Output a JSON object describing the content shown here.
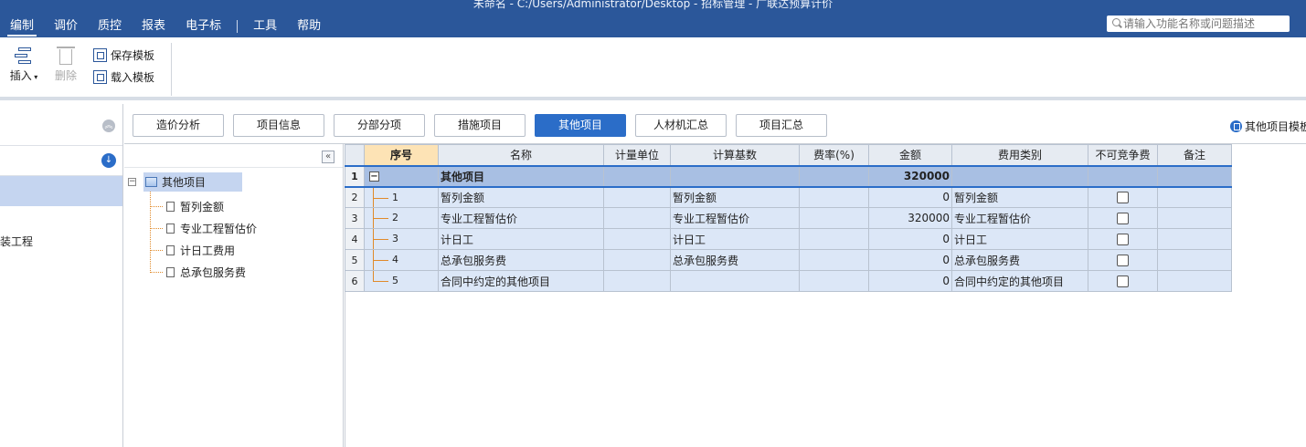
{
  "window": {
    "title": "未命名 - C:/Users/Administrator/Desktop - 招标管理 - 广联达预算计价"
  },
  "menu": {
    "items": [
      {
        "label": "编制",
        "active": true
      },
      {
        "label": "调价"
      },
      {
        "label": "质控"
      },
      {
        "label": "报表"
      },
      {
        "label": "电子标"
      },
      {
        "label": "工具"
      },
      {
        "label": "帮助"
      }
    ],
    "search_placeholder": "请输入功能名称或问题描述"
  },
  "ribbon": {
    "insert": "插入",
    "delete": "删除",
    "save_template": "保存模板",
    "load_template": "载入模板"
  },
  "left": {
    "partial_text": "装工程"
  },
  "tabs": [
    "造价分析",
    "项目信息",
    "分部分项",
    "措施项目",
    "其他项目",
    "人材机汇总",
    "项目汇总"
  ],
  "active_tab": "其他项目",
  "template_link": "其他项目模板",
  "tree": {
    "root": "其他项目",
    "children": [
      "暂列金额",
      "专业工程暂估价",
      "计日工费用",
      "总承包服务费"
    ]
  },
  "grid": {
    "columns": [
      "序号",
      "名称",
      "计量单位",
      "计算基数",
      "费率(%)",
      "金额",
      "费用类别",
      "不可竞争费",
      "备注"
    ],
    "rows": [
      {
        "rn": "1",
        "seq": "",
        "name": "其他项目",
        "unit": "",
        "base": "",
        "rate": "",
        "amount": "320000",
        "category": "",
        "checkbox": false
      },
      {
        "rn": "2",
        "seq": "1",
        "name": "暂列金额",
        "unit": "",
        "base": "暂列金额",
        "rate": "",
        "amount": "0",
        "category": "暂列金额",
        "checkbox": true
      },
      {
        "rn": "3",
        "seq": "2",
        "name": "专业工程暂估价",
        "unit": "",
        "base": "专业工程暂估价",
        "rate": "",
        "amount": "320000",
        "category": "专业工程暂估价",
        "checkbox": true
      },
      {
        "rn": "4",
        "seq": "3",
        "name": "计日工",
        "unit": "",
        "base": "计日工",
        "rate": "",
        "amount": "0",
        "category": "计日工",
        "checkbox": true
      },
      {
        "rn": "5",
        "seq": "4",
        "name": "总承包服务费",
        "unit": "",
        "base": "总承包服务费",
        "rate": "",
        "amount": "0",
        "category": "总承包服务费",
        "checkbox": true
      },
      {
        "rn": "6",
        "seq": "5",
        "name": "合同中约定的其他项目",
        "unit": "",
        "base": "",
        "rate": "",
        "amount": "0",
        "category": "合同中约定的其他项目",
        "checkbox": true
      }
    ]
  },
  "colors": {
    "titlebar": "#2b579a",
    "accent": "#2b6dc8",
    "row_bg": "#dce7f7",
    "header_seq": "#fde3b5"
  }
}
